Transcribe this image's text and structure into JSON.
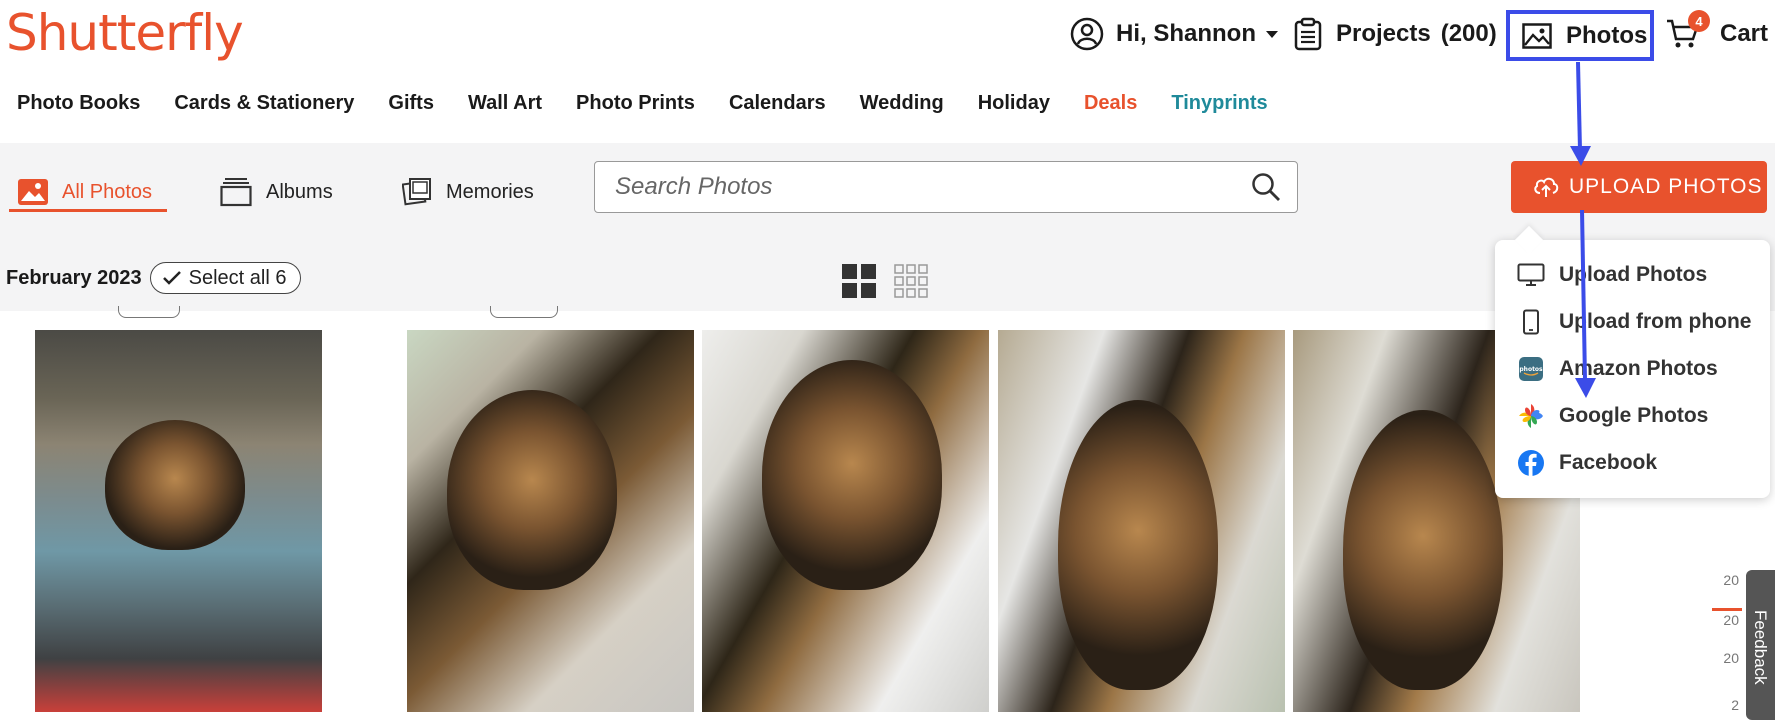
{
  "header": {
    "logo": "Shutterfly",
    "account_label": "Hi, Shannon",
    "projects_label": "Projects",
    "projects_count": "(200)",
    "photos_label": "Photos",
    "cart_label": "Cart",
    "cart_badge": "4"
  },
  "nav": {
    "items": [
      "Photo Books",
      "Cards & Stationery",
      "Gifts",
      "Wall Art",
      "Photo Prints",
      "Calendars",
      "Wedding",
      "Holiday",
      "Deals",
      "Tinyprints"
    ]
  },
  "toolbar": {
    "tabs": [
      {
        "label": "All Photos",
        "icon": "photo-icon",
        "active": true
      },
      {
        "label": "Albums",
        "icon": "album-icon",
        "active": false
      },
      {
        "label": "Memories",
        "icon": "memories-icon",
        "active": false
      }
    ],
    "search_placeholder": "Search Photos",
    "upload_label": "UPLOAD PHOTOS"
  },
  "grid": {
    "date": "February 2023",
    "select_all": "Select all 6"
  },
  "upload_menu": {
    "items": [
      {
        "label": "Upload Photos",
        "icon": "monitor-icon"
      },
      {
        "label": "Upload from phone",
        "icon": "phone-icon"
      },
      {
        "label": "Amazon Photos",
        "icon": "amazon-photos-icon"
      },
      {
        "label": "Google Photos",
        "icon": "google-photos-icon"
      },
      {
        "label": "Facebook",
        "icon": "facebook-icon"
      }
    ]
  },
  "feedback_label": "Feedback",
  "scrubber": [
    "20",
    "20",
    "20",
    "2"
  ],
  "colors": {
    "brand": "#e8522d",
    "annotation": "#3b4ce8",
    "tinyprints": "#1f8a9a"
  }
}
